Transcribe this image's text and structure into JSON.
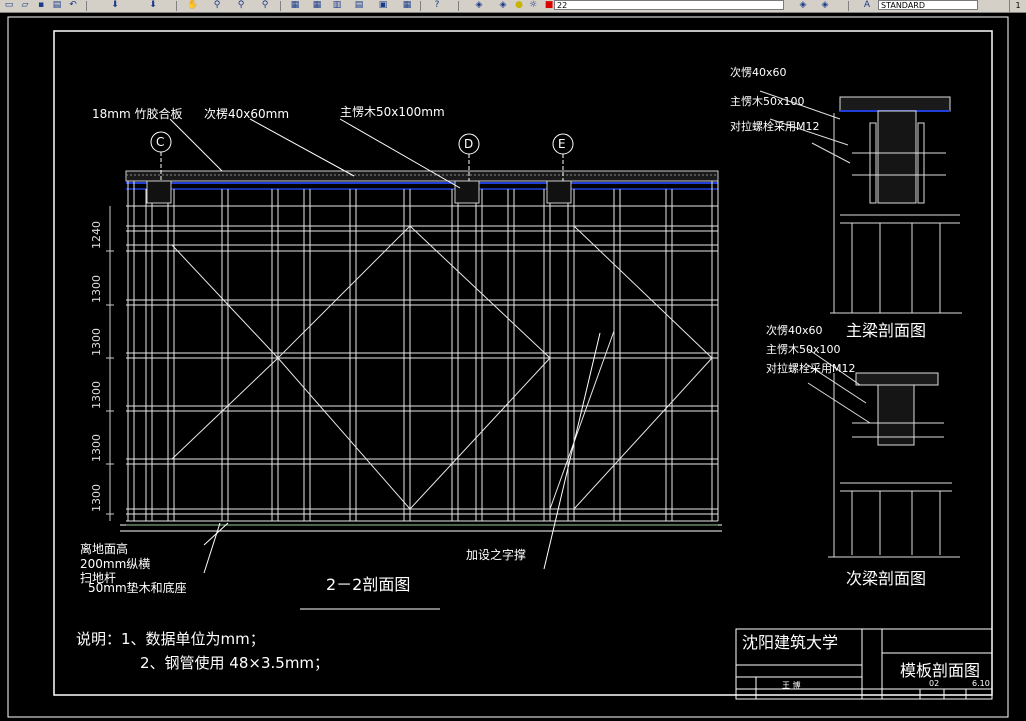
{
  "toolbar": {
    "layer_value": "22",
    "textstyle_value": "STANDARD",
    "close_glyph": "1",
    "icons": [
      "new-file-icon",
      "open-file-icon",
      "save-icon",
      "print-icon",
      "undo-icon",
      "redo-icon",
      "pan-icon",
      "zoom-realtime-icon",
      "zoom-window-icon",
      "zoom-previous-icon",
      "properties-icon",
      "design-center-icon",
      "tool-palette-icon",
      "help-icon",
      "layer-manager-icon",
      "layer-state-icon",
      "color-icon",
      "linetype-icon",
      "text-style-icon"
    ]
  },
  "drawing": {
    "main_section": {
      "label_bamboo_board": "18mm 竹胶合板",
      "label_secondary_beam": "次楞40x60mm",
      "label_main_beam": "主愣木50x100mm",
      "axis_c": "C",
      "axis_d": "D",
      "axis_e": "E",
      "dims_vertical": [
        "1240",
        "1300",
        "1300",
        "1300",
        "1300",
        "1300"
      ],
      "label_ground": "离地面高",
      "label_sweep_rod": "200mm纵横",
      "label_sweep_rod_2": "扫地杆",
      "label_base": "50mm垫木和底座",
      "label_bracing": "加设之字撑",
      "title": "2－2剖面图"
    },
    "main_beam_detail": {
      "label_secondary": "次愣40x60",
      "label_main": "主愣木50x100",
      "label_bolt": "对拉螺栓采用M12",
      "title": "主梁剖面图"
    },
    "secondary_beam_detail": {
      "label_secondary": "次愣40x60",
      "label_main": "主愣木50x100",
      "label_bolt": "对拉螺栓采用M12",
      "title": "次梁剖面图"
    },
    "notes": {
      "line1": "说明：1、数据单位为mm；",
      "line2": "2、钢管使用    48×3.5mm；"
    },
    "title_block": {
      "school": "沈阳建筑大学",
      "drawing_name": "模板剖面图",
      "designer": "王 博",
      "sheet_no": "02",
      "scale": "6.10"
    }
  }
}
